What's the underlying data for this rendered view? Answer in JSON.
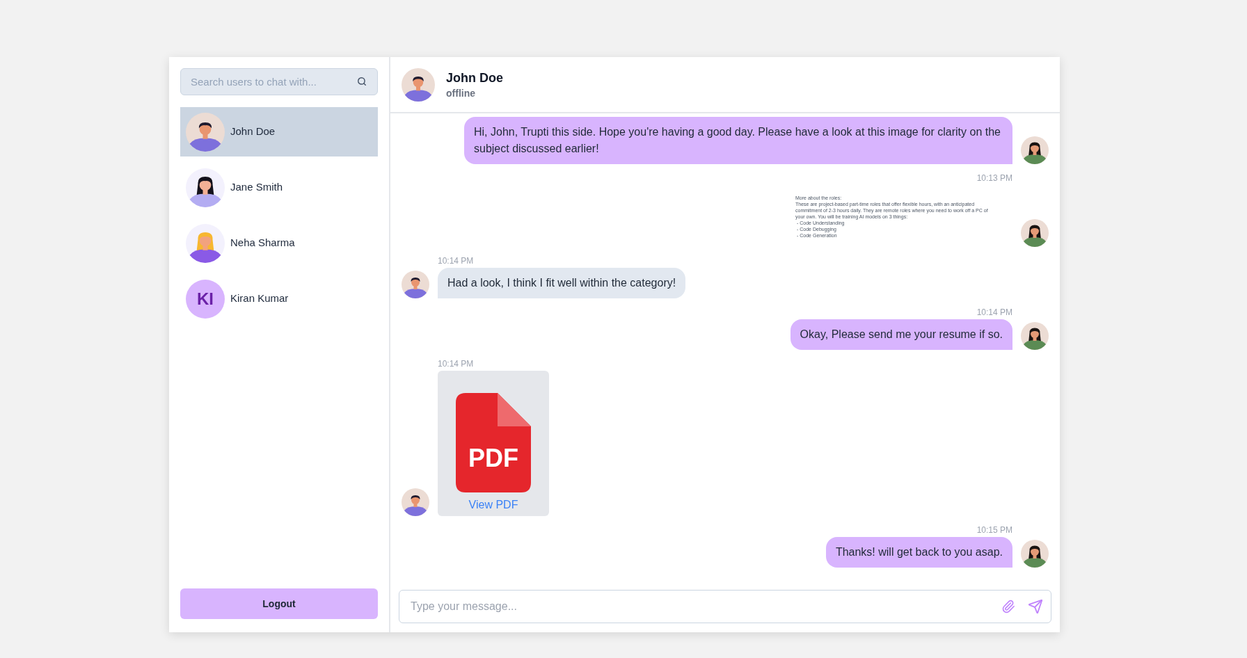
{
  "sidebar": {
    "search": {
      "placeholder": "Search users to chat with..."
    },
    "users": [
      {
        "name": "John Doe",
        "selected": true,
        "avatar": {
          "kind": "picture"
        }
      },
      {
        "name": "Jane Smith",
        "selected": false,
        "avatar": {
          "kind": "picture"
        }
      },
      {
        "name": "Neha Sharma",
        "selected": false,
        "avatar": {
          "kind": "picture"
        }
      },
      {
        "name": "Kiran Kumar",
        "selected": false,
        "avatar": {
          "kind": "initials",
          "text": "KI"
        }
      }
    ],
    "logout_button": "Logout"
  },
  "chat": {
    "header": {
      "name": "John Doe",
      "status": "offline"
    },
    "messages": [
      {
        "outgoing": true,
        "kind": "text",
        "text": "Hi, John, Trupti this side. Hope you're having a good day. Please have a look at this image for clarity on the subject discussed earlier!"
      },
      {
        "outgoing": true,
        "kind": "image",
        "time": "10:13 PM",
        "document": {
          "heading": "More about the roles:",
          "paragraph_lines": [
            "These are project-based part-time roles that offer flexible hours, with an anticipated",
            "commitment of 2-3 hours daily. They are remote roles where you need to work off a PC of",
            "your own. You will be training AI models on 3 things:"
          ],
          "bullets": [
            "- Code Understanding",
            "- Code Debugging",
            "- Code Generation"
          ]
        }
      },
      {
        "outgoing": false,
        "kind": "text",
        "time": "10:14 PM",
        "text": "Had a look, I think I fit well within the category!"
      },
      {
        "outgoing": true,
        "kind": "text",
        "time": "10:14 PM",
        "text": "Okay, Please send me your resume if so."
      },
      {
        "outgoing": false,
        "kind": "file",
        "time": "10:14 PM",
        "file_type": "PDF",
        "link": "View PDF"
      },
      {
        "outgoing": true,
        "kind": "text",
        "time": "10:15 PM",
        "text": "Thanks! will get back to you asap."
      }
    ],
    "composer": {
      "placeholder": "Type your message..."
    }
  }
}
